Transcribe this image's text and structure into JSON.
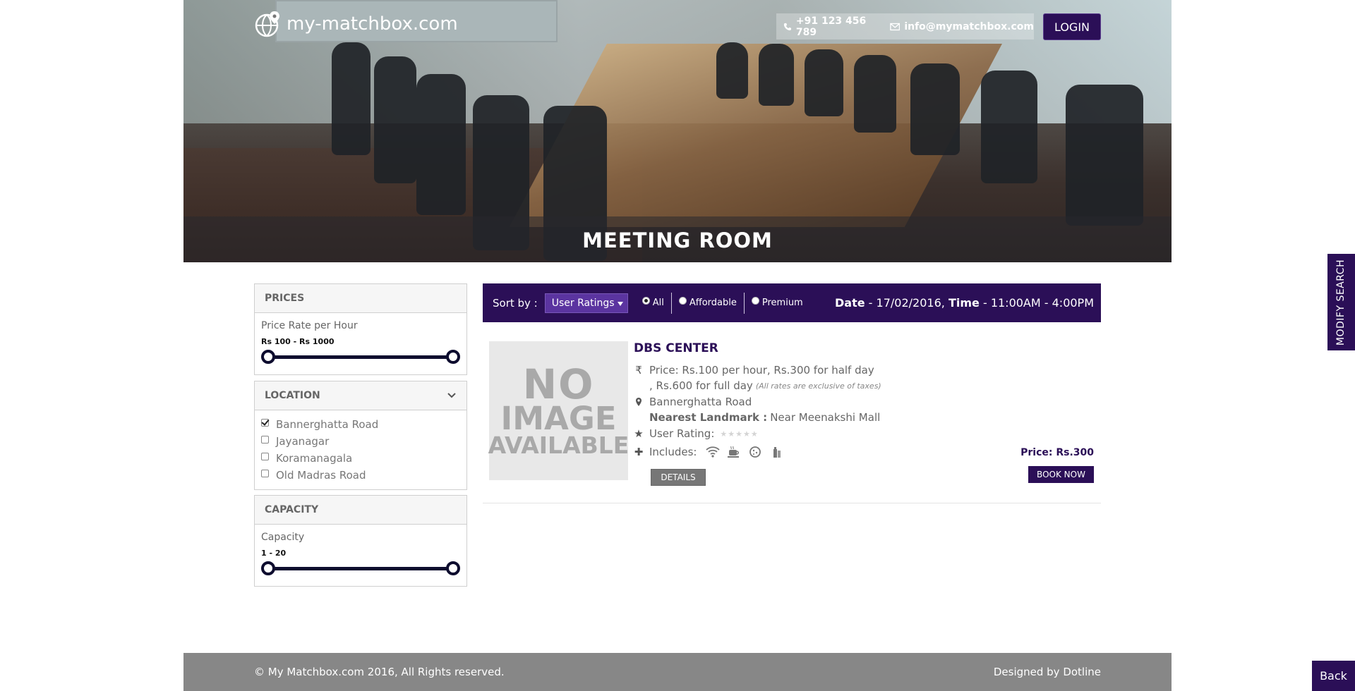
{
  "header": {
    "brand": "my-matchbox.com",
    "phone": "+91 123 456 789",
    "email": "info@mymatchbox.com",
    "login_label": "LOGIN",
    "hero_title": "MEETING ROOM"
  },
  "filters": {
    "prices": {
      "title": "PRICES",
      "subtitle": "Price Rate per Hour",
      "range": "Rs 100 - Rs 1000"
    },
    "location": {
      "title": "LOCATION",
      "items": [
        {
          "label": "Bannerghatta Road",
          "checked": true
        },
        {
          "label": "Jayanagar",
          "checked": false
        },
        {
          "label": "Koramanagala",
          "checked": false
        },
        {
          "label": "Old Madras Road",
          "checked": false
        }
      ]
    },
    "capacity": {
      "title": "CAPACITY",
      "subtitle": "Capacity",
      "range": "1 - 20"
    }
  },
  "sortbar": {
    "sort_label": "Sort by :",
    "sort_value": "User Ratings",
    "radios": [
      {
        "label": "All",
        "selected": true
      },
      {
        "label": "Affordable",
        "selected": false
      },
      {
        "label": "Premium",
        "selected": false
      }
    ],
    "date_label": "Date",
    "date_value": "- 17/02/2016,",
    "time_label": "Time",
    "time_value": "- 11:00AM - 4:00PM"
  },
  "listing": {
    "noimage_l1": "NO",
    "noimage_l2": "IMAGE",
    "noimage_l3": "AVAILABLE",
    "name": "DBS CENTER",
    "price_line1": "Price: Rs.100 per hour,  Rs.300 for half day",
    "price_line2": ",  Rs.600 for full day",
    "price_note": "(All rates are exclusive of taxes)",
    "address": "Bannerghatta Road",
    "landmark_label": "Nearest Landmark :",
    "landmark_value": "Near Meenakshi Mall",
    "rating_label": "User Rating:",
    "rating_stars": "★★★★★",
    "includes_label": "Includes:",
    "amenities": [
      "wifi-icon",
      "coffee-icon",
      "cookie-icon",
      "water-icon"
    ],
    "details_label": "DETAILS",
    "price_right": "Price: Rs.300",
    "book_label": "BOOK NOW"
  },
  "side_tab": "MODIFY SEARCH",
  "footer": {
    "copyright": "© My Matchbox.com 2016, All Rights reserved.",
    "designed_by": "Designed by Dotline",
    "back_label": "Back"
  },
  "colors": {
    "accent": "#2b0f57",
    "select": "#5b34a0",
    "footer": "#878787"
  }
}
